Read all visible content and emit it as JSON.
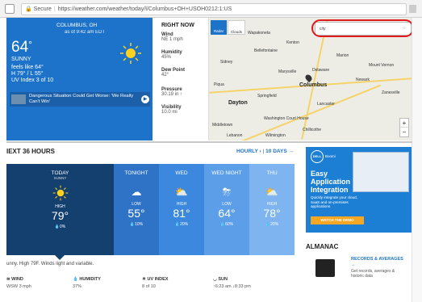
{
  "browser": {
    "secure_label": "Secure",
    "url": "https://weather.com/weather/today/l/Columbus+OH+USOH0212:1:US"
  },
  "hero": {
    "location": "COLUMBUS, OH",
    "asof": "as of 9:42 am EDT",
    "temp": "64",
    "degree": "°",
    "condition": "SUNNY",
    "feels": "feels like 64°",
    "hilo": "H 79° / L 55°",
    "uv": "UV Index 3 of 10",
    "story": "Dangerous Situation Could Get Worse: 'We Really Can't Win'"
  },
  "right_now": {
    "title": "RIGHT NOW",
    "items": [
      {
        "label": "Wind",
        "value": "NE 1 mph"
      },
      {
        "label": "Humidity",
        "value": "45%"
      },
      {
        "label": "Dew Point",
        "value": "42°"
      },
      {
        "label": "Pressure",
        "value": "30.19 in ↑"
      },
      {
        "label": "Visibility",
        "value": "10.0 mi"
      }
    ]
  },
  "map": {
    "search_value": "city",
    "zoom_plus": "+",
    "zoom_minus": "−",
    "radar": "Radar",
    "clouds": "Clouds",
    "cities": [
      "Wapakoneta",
      "Bellefontaine",
      "Marion",
      "Kenton",
      "Delaware",
      "Mount Vernon",
      "Sidney",
      "Marysville",
      "Piqua",
      "Newark",
      "Springfield",
      "Columbus",
      "Zanesville",
      "Dayton",
      "Lancaster",
      "Middletown",
      "Washington Court House",
      "Chillicothe",
      "Lebanon",
      "Wilmington"
    ]
  },
  "next36": {
    "title": "IEXT 36 HOURS",
    "hourly": "HOURLY",
    "tendays": "10 DAYS",
    "periods": [
      {
        "name": "TODAY",
        "sub": "SUNNY",
        "lh": "HIGH",
        "temp": "79°",
        "precip": "0%"
      },
      {
        "name": "TONIGHT",
        "sub": "",
        "lh": "LOW",
        "temp": "55°",
        "precip": "10%"
      },
      {
        "name": "WED",
        "sub": "",
        "lh": "HIGH",
        "temp": "81°",
        "precip": "20%"
      },
      {
        "name": "WED NIGHT",
        "sub": "",
        "lh": "LOW",
        "temp": "64°",
        "precip": "60%"
      },
      {
        "name": "THU",
        "sub": "",
        "lh": "HIGH",
        "temp": "78°",
        "precip": "20%"
      }
    ],
    "narrative": "unny. High 79F. Winds light and variable.",
    "details": [
      {
        "label": "WIND",
        "value": "WSW 3 mph"
      },
      {
        "label": "HUMIDITY",
        "value": "37%"
      },
      {
        "label": "UV INDEX",
        "value": "8 of 10"
      },
      {
        "label": "SUN",
        "value": "↑6:23 am  ↓8:33 pm"
      }
    ]
  },
  "ad": {
    "brand": "DELL",
    "brand2": "Boomi",
    "headline": "Easy Application Integration",
    "body": "Quickly integrate your cloud, SaaS and on-premises applications",
    "cta": "WATCH THE DEMO"
  },
  "almanac": {
    "title": "ALMANAC",
    "link": "RECORDS & AVERAGES",
    "desc": "Get records, averages & historic data"
  }
}
